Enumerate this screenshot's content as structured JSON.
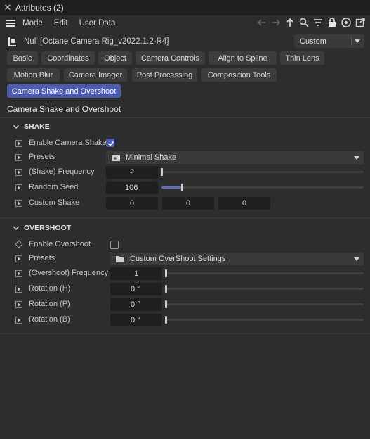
{
  "window": {
    "title": "Attributes (2)"
  },
  "menu": {
    "items": [
      "Mode",
      "Edit",
      "User Data"
    ]
  },
  "toolbar_icons": [
    "back-arrow-icon",
    "forward-arrow-icon",
    "up-arrow-icon",
    "search-icon",
    "filter-icon",
    "lock-icon",
    "target-icon",
    "new-window-icon"
  ],
  "object": {
    "name": "Null [Octane Camera Rig_v2022.1.2-R4]",
    "preset": "Custom"
  },
  "tabs": [
    "Basic",
    "Coordinates",
    "Object",
    "Camera Controls",
    "Align to Spline",
    "Thin Lens",
    "Motion Blur",
    "Camera Imager",
    "Post Processing",
    "Composition Tools",
    "Camera Shake and Overshoot"
  ],
  "active_tab": "Camera Shake and Overshoot",
  "section_title": "Camera Shake and Overshoot",
  "shake": {
    "header": "SHAKE",
    "enable_label": "Enable Camera Shake",
    "enable_checked": true,
    "presets_label": "Presets",
    "presets_value": "Minimal Shake",
    "frequency_label": "(Shake) Frequency",
    "frequency_value": "2",
    "seed_label": "Random Seed",
    "seed_value": "106",
    "seed_slider_fraction": 0.1,
    "custom_label": "Custom Shake",
    "custom_values": [
      "0",
      "0",
      "0"
    ]
  },
  "overshoot": {
    "header": "OVERSHOOT",
    "enable_label": "Enable Overshoot",
    "enable_checked": false,
    "presets_label": "Presets",
    "presets_value": "Custom OverShoot Settings",
    "frequency_label": "(Overshoot) Frequency",
    "frequency_value": "1",
    "rot_h_label": "Rotation (H)",
    "rot_h_value": "0 °",
    "rot_p_label": "Rotation (P)",
    "rot_p_value": "0 °",
    "rot_b_label": "Rotation (B)",
    "rot_b_value": "0 °"
  },
  "colors": {
    "accent": "#4a5bb0",
    "background": "#2d2d2d",
    "field": "#1f1f1f"
  }
}
